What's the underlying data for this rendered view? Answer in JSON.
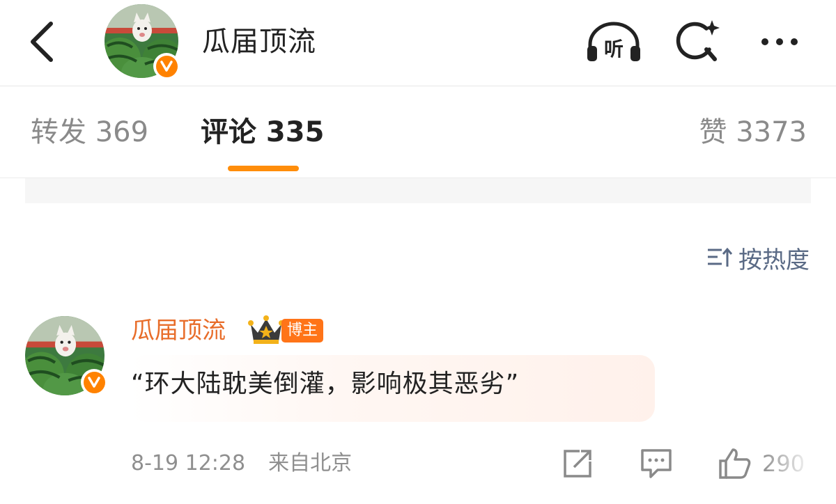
{
  "header": {
    "title": "瓜届顶流",
    "listen_icon_label": "听",
    "icons": [
      "back-arrow-icon",
      "headphones-listen-icon",
      "search-sparkle-icon",
      "more-dots-icon"
    ]
  },
  "tabs": [
    {
      "label": "转发 369",
      "active": false
    },
    {
      "label": "评论 335",
      "active": true
    },
    {
      "label": "赞 3373",
      "active": false
    }
  ],
  "sort": {
    "label": "按热度",
    "icon": "sort-icon"
  },
  "comment": {
    "author": "瓜届顶流",
    "badge": "博主",
    "text": "“环大陆耽美倒灌，影响极其恶劣”",
    "time": "8-19 12:28",
    "location": "来自北京",
    "like_count": "290"
  },
  "colors": {
    "accent": "#ff8d0a",
    "author_name": "#e86d2a",
    "verified_badge": "#ff8200",
    "sort_text": "#5a6a85"
  }
}
